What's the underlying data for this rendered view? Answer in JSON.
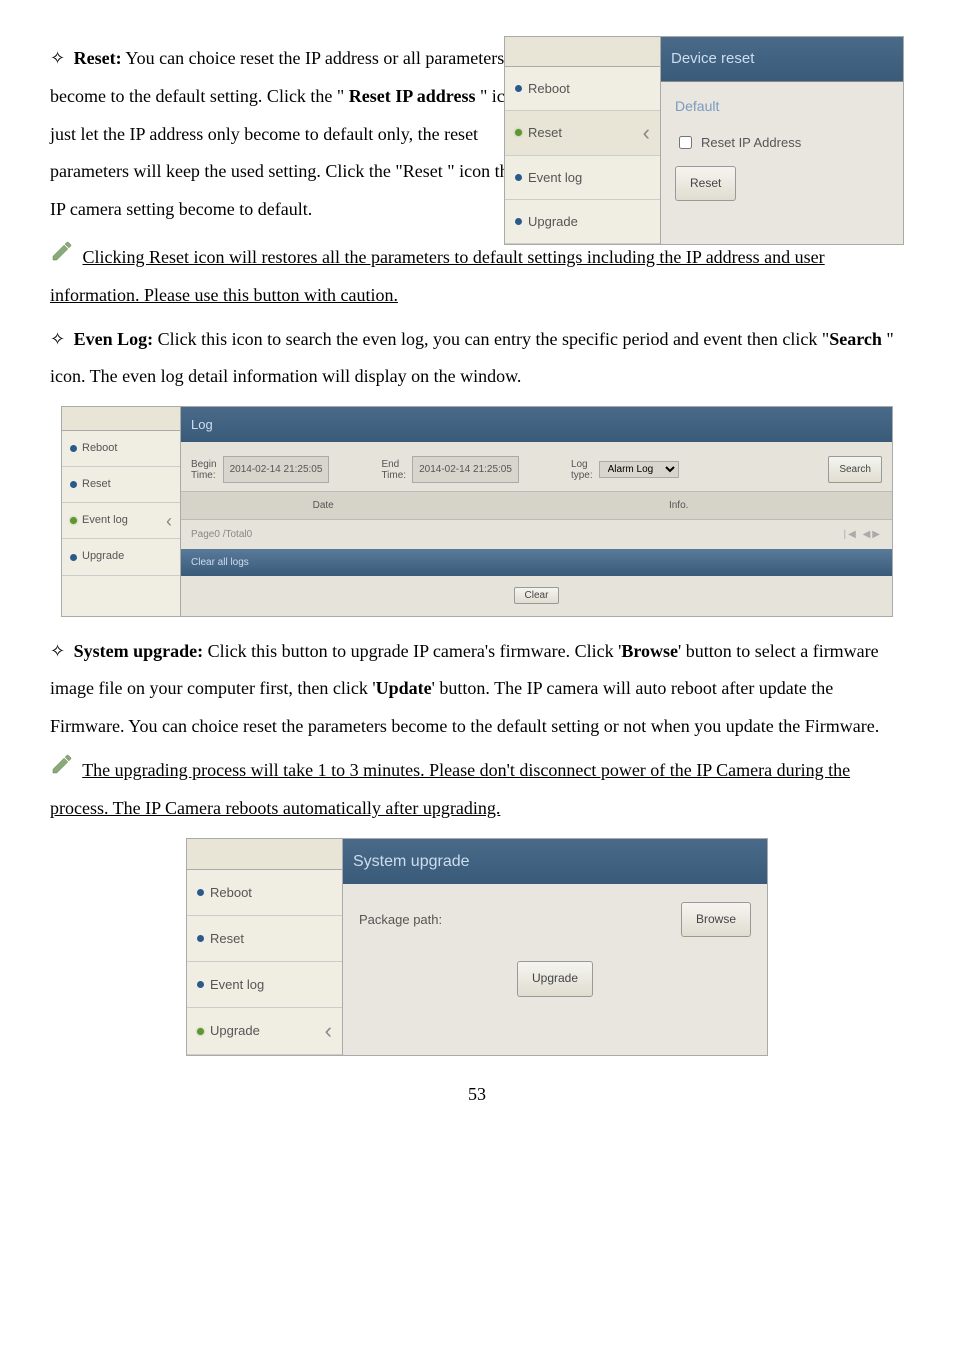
{
  "reset_section": {
    "icon": "✧",
    "label": "Reset:",
    "text1": " You can choice reset the IP address or all parameters become to the default setting. Click the \" ",
    "bold1": "Reset IP address",
    "text2": " \" icon just let the IP address only become to default only, the reset parameters will keep the used setting. Click the \"Reset \" icon the IP camera setting become to default."
  },
  "device_reset_panel": {
    "header": "Device reset",
    "default_label": "Default",
    "sidebar": [
      "Reboot",
      "Reset",
      "Event log",
      "Upgrade"
    ],
    "checkbox_label": "Reset IP Address",
    "reset_btn": "Reset"
  },
  "caution_note": "Clicking Reset icon will restores all the parameters to default settings including the IP address and user information. Please use this button with caution.",
  "evenlog_section": {
    "icon": "✧",
    "label": "Even Log:",
    "text1": " Click this icon to search the even log, you can entry the specific period and event then click \"",
    "bold1": "Search",
    "text2": " \" icon.    The even log detail information will display on the window."
  },
  "log_panel": {
    "header": "Log",
    "sidebar": [
      "Reboot",
      "Reset",
      "Event log",
      "Upgrade"
    ],
    "begin_label": "Begin\nTime:",
    "begin_time": "2014-02-14 21:25:05",
    "end_label": "End\nTime:",
    "end_time": "2014-02-14 21:25:05",
    "logtype_label": "Log\ntype:",
    "logtype_value": "Alarm Log",
    "search_btn": "Search",
    "col_date": "Date",
    "col_info": "Info.",
    "pager": "Page0 /Total0",
    "pager_nav": "|◀ ◀▶",
    "clear_all": "Clear all logs",
    "clear_btn": "Clear"
  },
  "system_upgrade_section": {
    "icon": "✧",
    "label": "System upgrade:",
    "text1": " Click this button to upgrade IP camera's firmware.    Click '",
    "bold1": "Browse",
    "text2": "' button to select a firmware image file on your computer first, then click '",
    "bold2": "Update",
    "text3": "' button.    The IP camera will auto reboot after update the Firmware. You can choice reset the parameters become to the default setting or not when you update the Firmware."
  },
  "upgrade_note": "The upgrading process will take 1 to 3 minutes.    Please don't disconnect power of the IP Camera during the process. The IP Camera reboots automatically after upgrading.",
  "upgrade_panel": {
    "header": "System upgrade",
    "sidebar": [
      "Reboot",
      "Reset",
      "Event log",
      "Upgrade"
    ],
    "package_label": "Package path:",
    "browse_btn": "Browse",
    "upgrade_btn": "Upgrade"
  },
  "page_number": "53"
}
